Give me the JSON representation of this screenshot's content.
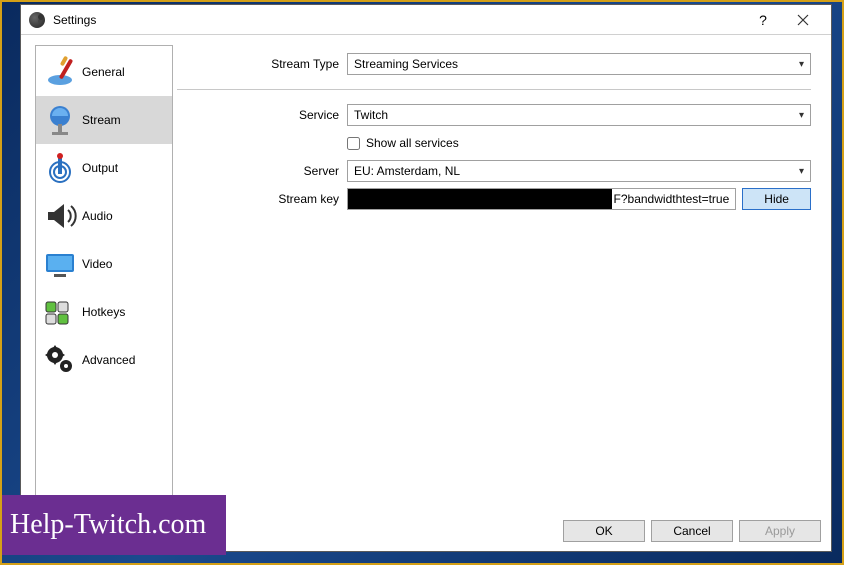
{
  "window": {
    "title": "Settings"
  },
  "sidebar": {
    "items": [
      {
        "label": "General"
      },
      {
        "label": "Stream"
      },
      {
        "label": "Output"
      },
      {
        "label": "Audio"
      },
      {
        "label": "Video"
      },
      {
        "label": "Hotkeys"
      },
      {
        "label": "Advanced"
      }
    ]
  },
  "form": {
    "stream_type_label": "Stream Type",
    "stream_type_value": "Streaming Services",
    "service_label": "Service",
    "service_value": "Twitch",
    "show_all_label": "Show all services",
    "server_label": "Server",
    "server_value": "EU: Amsterdam, NL",
    "stream_key_label": "Stream key",
    "stream_key_visible_suffix": "F?bandwidthtest=true",
    "hide_button": "Hide"
  },
  "footer": {
    "ok": "OK",
    "cancel": "Cancel",
    "apply": "Apply"
  },
  "watermark": "Help-Twitch.com"
}
